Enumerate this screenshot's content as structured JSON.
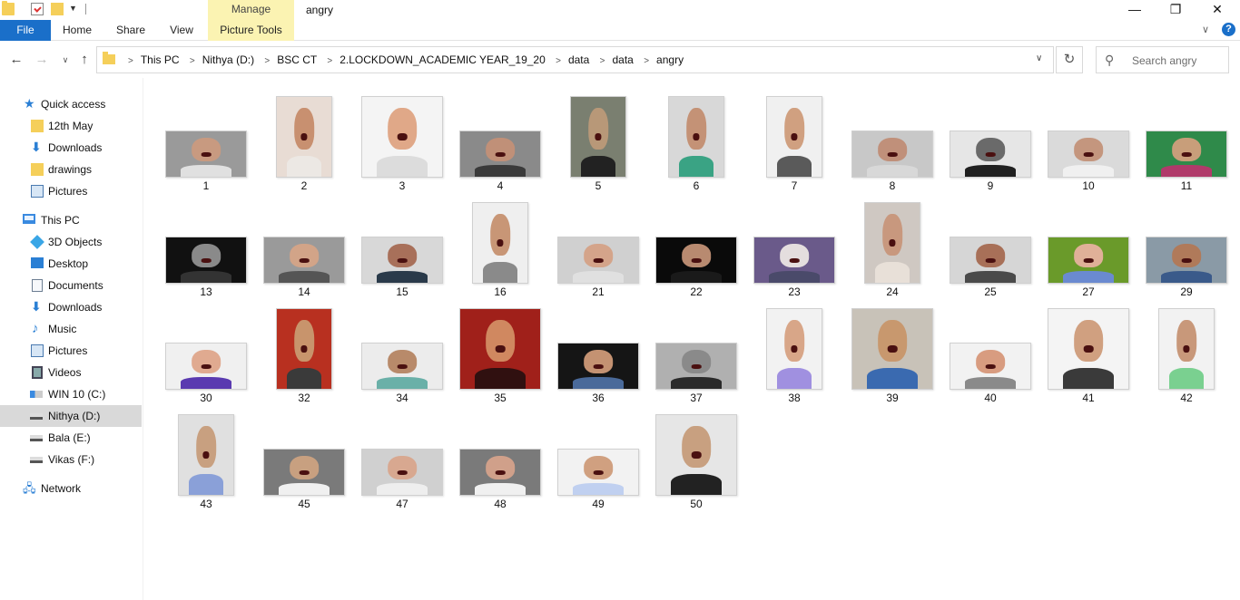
{
  "window": {
    "title": "angry",
    "manage_label": "Manage",
    "minimize_glyph": "—",
    "maximize_glyph": "❐",
    "close_glyph": "✕"
  },
  "ribbon": {
    "file": "File",
    "home": "Home",
    "share": "Share",
    "view": "View",
    "picture_tools": "Picture Tools",
    "expand_glyph": "∨",
    "help_glyph": "?"
  },
  "nav": {
    "back_glyph": "←",
    "forward_glyph": "→",
    "recent_glyph": "∨",
    "up_glyph": "↑",
    "refresh_glyph": "↻",
    "dropdown_glyph": "∨"
  },
  "address": {
    "crumbs": [
      "This PC",
      "Nithya (D:)",
      "BSC CT",
      "2.LOCKDOWN_ACADEMIC YEAR_19_20",
      "data",
      "data",
      "angry"
    ],
    "separator": ">"
  },
  "search": {
    "placeholder": "Search angry",
    "icon": "search-icon"
  },
  "sidebar": {
    "items": [
      {
        "label": "Quick access",
        "icon": "star-icon"
      },
      {
        "label": "12th May",
        "icon": "folder-icon"
      },
      {
        "label": "Downloads",
        "icon": "download-icon"
      },
      {
        "label": "drawings",
        "icon": "folder-icon"
      },
      {
        "label": "Pictures",
        "icon": "pictures-icon"
      },
      {
        "label": "This PC",
        "icon": "computer-icon"
      },
      {
        "label": "3D Objects",
        "icon": "cube-icon"
      },
      {
        "label": "Desktop",
        "icon": "desktop-icon"
      },
      {
        "label": "Documents",
        "icon": "documents-icon"
      },
      {
        "label": "Downloads",
        "icon": "download-icon"
      },
      {
        "label": "Music",
        "icon": "music-icon"
      },
      {
        "label": "Pictures",
        "icon": "pictures-icon"
      },
      {
        "label": "Videos",
        "icon": "videos-icon"
      },
      {
        "label": "WIN 10 (C:)",
        "icon": "os-drive-icon"
      },
      {
        "label": "Nithya (D:)",
        "icon": "drive-icon"
      },
      {
        "label": "Bala (E:)",
        "icon": "drive-icon"
      },
      {
        "label": "Vikas (F:)",
        "icon": "drive-icon"
      },
      {
        "label": "Network",
        "icon": "network-icon"
      }
    ],
    "selected": "Nithya (D:)"
  },
  "files": [
    {
      "name": "1",
      "bg": "#9a9a9a",
      "skin": "#c89a80",
      "shirt": "#e0e0e0"
    },
    {
      "name": "2",
      "bg": "#e8dcd4",
      "skin": "#c89070",
      "shirt": "#ece8e4"
    },
    {
      "name": "3",
      "bg": "#f4f4f4",
      "skin": "#e0a888",
      "shirt": "#dcdcdc"
    },
    {
      "name": "4",
      "bg": "#8a8a8a",
      "skin": "#c09078",
      "shirt": "#3a3a3a"
    },
    {
      "name": "5",
      "bg": "#7a7f70",
      "skin": "#b89878",
      "shirt": "#222222"
    },
    {
      "name": "6",
      "bg": "#d8d8d8",
      "skin": "#c49276",
      "shirt": "#3aa384"
    },
    {
      "name": "7",
      "bg": "#f0f0f0",
      "skin": "#d0a080",
      "shirt": "#5a5a5a"
    },
    {
      "name": "8",
      "bg": "#c8c8c8",
      "skin": "#c0907a",
      "shirt": "#d8d8d8"
    },
    {
      "name": "9",
      "bg": "#e6e6e6",
      "skin": "#6a6a6a",
      "shirt": "#202020"
    },
    {
      "name": "10",
      "bg": "#dadada",
      "skin": "#c4967e",
      "shirt": "#f0f0f0"
    },
    {
      "name": "11",
      "bg": "#2f8a4a",
      "skin": "#c89e7a",
      "shirt": "#b03a6a"
    },
    {
      "name": "13",
      "bg": "#111111",
      "skin": "#8a8a8a",
      "shirt": "#333333"
    },
    {
      "name": "14",
      "bg": "#9a9a9a",
      "skin": "#d2a488",
      "shirt": "#555555"
    },
    {
      "name": "15",
      "bg": "#d8d8d8",
      "skin": "#a8705a",
      "shirt": "#2a3a4a"
    },
    {
      "name": "16",
      "bg": "#efefef",
      "skin": "#c89676",
      "shirt": "#8a8a8a"
    },
    {
      "name": "21",
      "bg": "#d0d0d0",
      "skin": "#d4a48a",
      "shirt": "#e0e0e0"
    },
    {
      "name": "22",
      "bg": "#0a0a0a",
      "skin": "#b88a70",
      "shirt": "#1a1a1a"
    },
    {
      "name": "23",
      "bg": "#6a5a8a",
      "skin": "#e4dede",
      "shirt": "#4a4a6a"
    },
    {
      "name": "24",
      "bg": "#cfc8c2",
      "skin": "#c8987e",
      "shirt": "#e8e0d8"
    },
    {
      "name": "25",
      "bg": "#d6d6d6",
      "skin": "#a87058",
      "shirt": "#4a4a4a"
    },
    {
      "name": "27",
      "bg": "#6a9a2a",
      "skin": "#e0b098",
      "shirt": "#6a8ad0"
    },
    {
      "name": "29",
      "bg": "#8a9aa6",
      "skin": "#b07a5a",
      "shirt": "#3a5a8a"
    },
    {
      "name": "30",
      "bg": "#f0f0f0",
      "skin": "#e0aa90",
      "shirt": "#5a3ab0"
    },
    {
      "name": "32",
      "bg": "#b83020",
      "skin": "#c8946c",
      "shirt": "#3a3a3a"
    },
    {
      "name": "34",
      "bg": "#ececec",
      "skin": "#b88a6a",
      "shirt": "#6ab0a8"
    },
    {
      "name": "35",
      "bg": "#a0201a",
      "skin": "#d08860",
      "shirt": "#301010"
    },
    {
      "name": "36",
      "bg": "#151515",
      "skin": "#c49272",
      "shirt": "#4a6a9a"
    },
    {
      "name": "37",
      "bg": "#b0b0b0",
      "skin": "#8a8a8a",
      "shirt": "#2a2a2a"
    },
    {
      "name": "38",
      "bg": "#f2f2f2",
      "skin": "#d8a688",
      "shirt": "#a090e0"
    },
    {
      "name": "39",
      "bg": "#c8c2b8",
      "skin": "#c8986e",
      "shirt": "#3a6ab0"
    },
    {
      "name": "40",
      "bg": "#f2f2f2",
      "skin": "#d89c80",
      "shirt": "#8a8a8a"
    },
    {
      "name": "41",
      "bg": "#f4f4f4",
      "skin": "#d0a080",
      "shirt": "#3a3a3a"
    },
    {
      "name": "42",
      "bg": "#f2f2f2",
      "skin": "#c8987a",
      "shirt": "#7ad090"
    },
    {
      "name": "43",
      "bg": "#e0e0e0",
      "skin": "#c8a080",
      "shirt": "#8aa0d8"
    },
    {
      "name": "45",
      "bg": "#7a7a7a",
      "skin": "#c8a080",
      "shirt": "#f0f0f0"
    },
    {
      "name": "47",
      "bg": "#d0d0d0",
      "skin": "#d8a890",
      "shirt": "#eeeeee"
    },
    {
      "name": "48",
      "bg": "#7a7a7a",
      "skin": "#d0a08a",
      "shirt": "#f0f0f0"
    },
    {
      "name": "49",
      "bg": "#f2f2f2",
      "skin": "#d0a080",
      "shirt": "#c0d0f0"
    },
    {
      "name": "50",
      "bg": "#e6e6e6",
      "skin": "#c8a080",
      "shirt": "#222222"
    }
  ],
  "thumb_shape": [
    "wide",
    "tall",
    "square",
    "wide",
    "tall",
    "tall",
    "tall",
    "wide",
    "wide",
    "wide",
    "wide",
    "wide",
    "wide",
    "wide",
    "tall",
    "wide",
    "wide",
    "wide",
    "tall",
    "wide",
    "wide",
    "wide",
    "wide",
    "tall",
    "wide",
    "square",
    "wide",
    "wide",
    "tall",
    "square",
    "wide",
    "square",
    "tall",
    "tall",
    "wide",
    "wide",
    "wide",
    "wide",
    "square"
  ]
}
